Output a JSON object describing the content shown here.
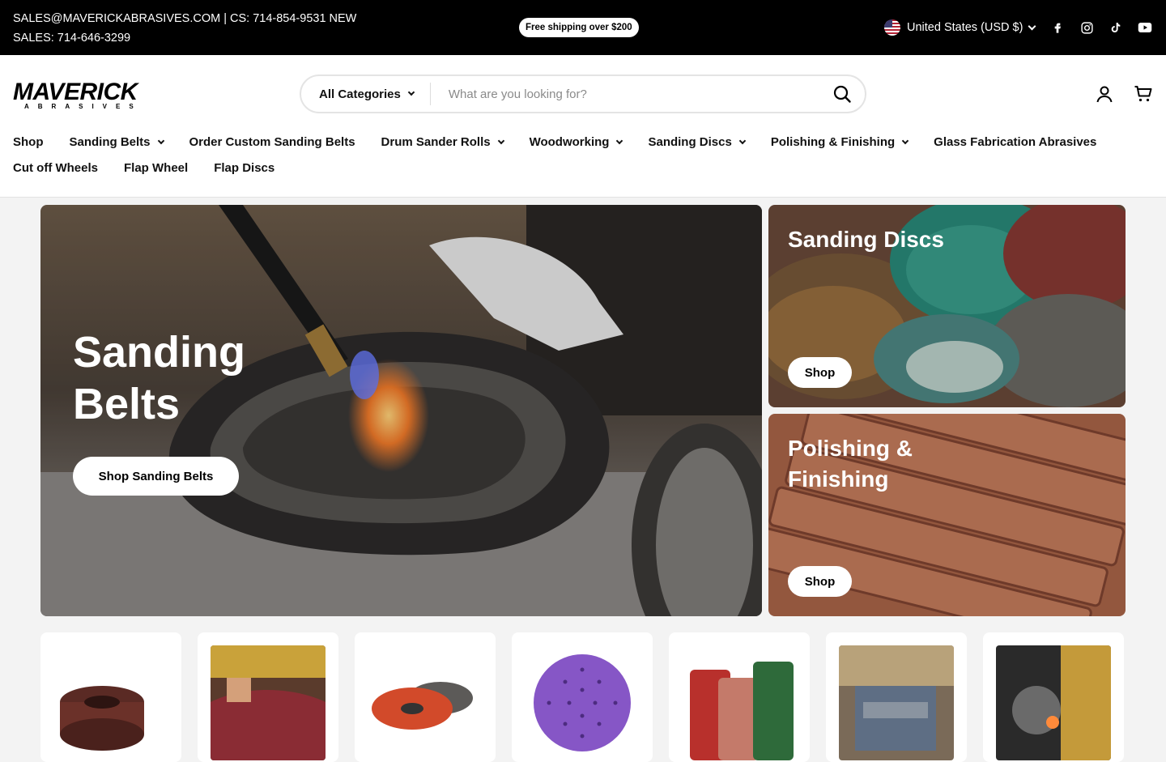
{
  "topbar": {
    "contact": "SALES@MAVERICKABRASIVES.COM | CS: 714-854-9531 NEW SALES: 714-646-3299",
    "promo": "Free shipping over $200",
    "locale": "United States (USD $)",
    "socials": [
      "facebook-icon",
      "instagram-icon",
      "tiktok-icon",
      "youtube-icon"
    ]
  },
  "header": {
    "logo_text": "MAVERICK",
    "logo_sub": "ABRASIVES",
    "search": {
      "category_label": "All Categories",
      "placeholder": "What are you looking for?"
    }
  },
  "nav": {
    "items": [
      {
        "label": "Shop"
      },
      {
        "label": "Sanding Belts"
      },
      {
        "label": "Order Custom Sanding Belts"
      },
      {
        "label": "Drum Sander Rolls"
      },
      {
        "label": "Woodworking"
      },
      {
        "label": "Sanding Discs"
      },
      {
        "label": "Polishing & Finishing"
      },
      {
        "label": "Glass Fabrication Abrasives"
      },
      {
        "label": "Cut off Wheels"
      },
      {
        "label": "Flap Wheel"
      },
      {
        "label": "Flap Discs"
      }
    ]
  },
  "hero": {
    "title": "Sanding Belts",
    "button": "Shop Sanding Belts"
  },
  "tiles": [
    {
      "title": "Sanding Discs",
      "button": "Shop"
    },
    {
      "title": "Polishing & Finishing",
      "button": "Shop"
    }
  ],
  "colors": {
    "topbar_bg": "#000000",
    "page_bg": "#f3f3f3",
    "accent": "#ffffff"
  }
}
